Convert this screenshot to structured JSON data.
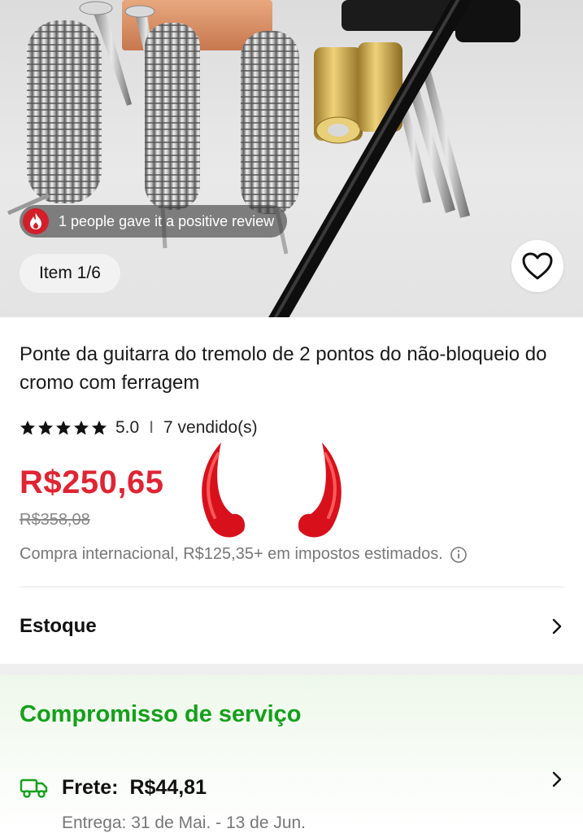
{
  "gallery": {
    "review_text": "1 people gave it a positive review",
    "item_counter": "Item 1/6"
  },
  "product": {
    "title": "Ponte da guitarra do tremolo de 2 pontos do não-bloqueio do cromo com ferragem",
    "rating": "5.0",
    "rating_separator": "I",
    "sold": "7 vendido(s)",
    "stars": 5,
    "price": "R$250,65",
    "old_price": "R$358,08",
    "tax_note": "Compra internacional, R$125,35+ em impostos estimados."
  },
  "stock": {
    "label": "Estoque"
  },
  "service": {
    "title": "Compromisso de serviço",
    "shipping_label": "Frete:",
    "shipping_value": "R$44,81",
    "delivery": "Entrega: 31 de Mai. - 13 de Jun."
  },
  "colors": {
    "price": "#e02433",
    "service_green": "#14a01a",
    "fire_badge": "#d21f2a",
    "horn_red": "#d8101c"
  },
  "icons": [
    "fire-icon",
    "heart-icon",
    "star-icon",
    "chevron-right-icon",
    "info-icon",
    "truck-icon",
    "devil-horn-sticker"
  ]
}
